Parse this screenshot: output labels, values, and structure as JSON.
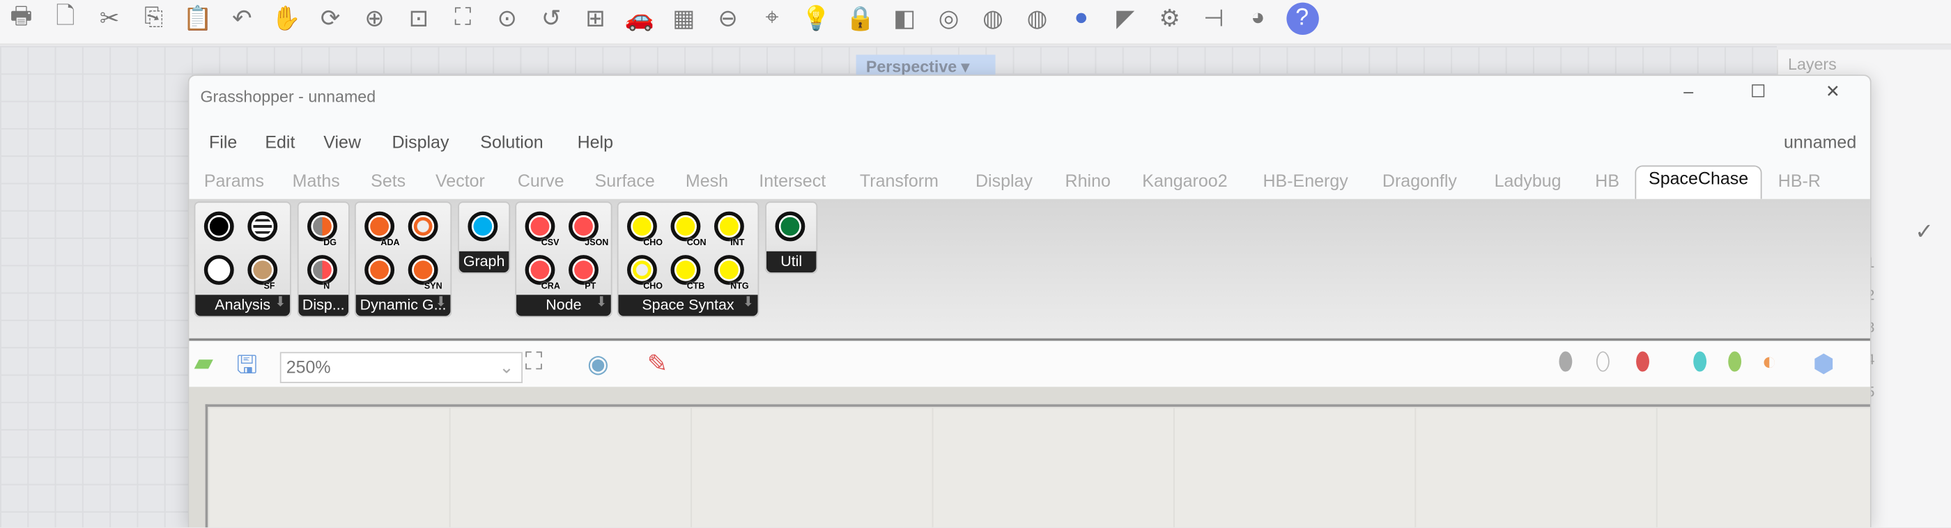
{
  "rhino": {
    "toolbar_icons": [
      "print-icon",
      "new-icon",
      "cut-icon",
      "copy-icon",
      "paste-icon",
      "undo-icon",
      "pan-icon",
      "rotate-icon",
      "zoom-icon",
      "zoom-window-icon",
      "zoom-extents-icon",
      "zoom-selected-icon",
      "undo-view-icon",
      "viewports-icon",
      "car-icon",
      "grid-icon",
      "point-icon",
      "object-snap-icon",
      "light-icon",
      "lock-icon",
      "render-icon",
      "color-wheel-icon",
      "sphere-wire-icon",
      "sphere-grid-icon",
      "sphere-shaded-icon",
      "pen-icon",
      "gear-icon",
      "dimension-icon",
      "globe-icon",
      "help-icon"
    ],
    "viewport_label": "Perspective",
    "panel_title": "Layers",
    "layer_rows": [
      "1",
      "2",
      "3",
      "4",
      "5"
    ]
  },
  "window": {
    "title": "Grasshopper - unnamed",
    "doc_name": "unnamed"
  },
  "menu": [
    "File",
    "Edit",
    "View",
    "Display",
    "Solution",
    "Help"
  ],
  "tabs": [
    "Params",
    "Maths",
    "Sets",
    "Vector",
    "Curve",
    "Surface",
    "Mesh",
    "Intersect",
    "Transform",
    "Display",
    "Rhino",
    "Kangaroo2",
    "HB-Energy",
    "Dragonfly",
    "Ladybug",
    "HB",
    "SpaceChase",
    "HB-R"
  ],
  "active_tab": "SpaceChase",
  "groups": [
    {
      "label": "Analysis",
      "components": [
        {
          "color": "#000000",
          "label": ""
        },
        {
          "color": "#ffffff",
          "label": "",
          "icon": "lines"
        },
        {
          "color": "#ffffff",
          "label": ""
        },
        {
          "color": "#c49a6c",
          "label": "SF"
        }
      ]
    },
    {
      "label": "Disp...",
      "components": [
        {
          "color": "#f26522",
          "label": "DG",
          "icon": "hatched"
        },
        {
          "color": "#ff5050",
          "label": "N",
          "icon": "hatched"
        }
      ]
    },
    {
      "label": "Dynamic G...",
      "components": [
        {
          "color": "#f26522",
          "label": "ADA"
        },
        {
          "color": "#f26522",
          "label": "",
          "icon": "ring"
        },
        {
          "color": "#f26522",
          "label": ""
        },
        {
          "color": "#f26522",
          "label": "SYN"
        }
      ]
    },
    {
      "label": "Graph",
      "components": [
        {
          "color": "#00aeef",
          "label": ""
        }
      ]
    },
    {
      "label": "Node",
      "components": [
        {
          "color": "#ff5050",
          "label": "CSV"
        },
        {
          "color": "#ff5050",
          "label": "JSON"
        },
        {
          "color": "#ff5050",
          "label": "CRA"
        },
        {
          "color": "#ff5050",
          "label": "PT"
        }
      ]
    },
    {
      "label": "Space Syntax",
      "components": [
        {
          "color": "#fff200",
          "label": "CHO"
        },
        {
          "color": "#fff200",
          "label": "CON"
        },
        {
          "color": "#fff200",
          "label": "INT"
        },
        {
          "color": "#fff200",
          "label": "CHO",
          "icon": "ring"
        },
        {
          "color": "#fff200",
          "label": "CTB"
        },
        {
          "color": "#fff200",
          "label": "NTG"
        }
      ]
    },
    {
      "label": "Util",
      "components": [
        {
          "color": "#0a7a3a",
          "label": ""
        }
      ]
    }
  ],
  "canvas_toolbar": {
    "zoom": "250%"
  }
}
